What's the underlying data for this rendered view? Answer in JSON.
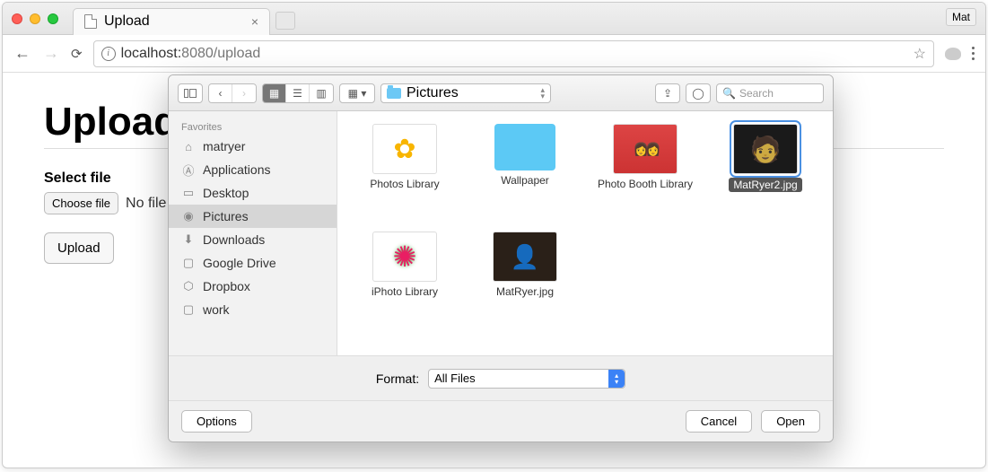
{
  "browser": {
    "tab_title": "Upload",
    "user_badge": "Mat",
    "url_host": "localhost:",
    "url_port_path": "8080/upload"
  },
  "page": {
    "heading": "Upload",
    "label": "Select file",
    "choose_btn": "Choose file",
    "nofile": "No file",
    "upload_btn": "Upload"
  },
  "dialog": {
    "location": "Pictures",
    "search_placeholder": "Search",
    "sidebar_header": "Favorites",
    "sidebar": [
      {
        "icon": "home",
        "label": "matryer"
      },
      {
        "icon": "apps",
        "label": "Applications"
      },
      {
        "icon": "desktop",
        "label": "Desktop"
      },
      {
        "icon": "pictures",
        "label": "Pictures",
        "active": true
      },
      {
        "icon": "downloads",
        "label": "Downloads"
      },
      {
        "icon": "folder",
        "label": "Google Drive"
      },
      {
        "icon": "dropbox",
        "label": "Dropbox"
      },
      {
        "icon": "folder",
        "label": "work"
      }
    ],
    "items": [
      {
        "name": "Photos Library",
        "type": "photos"
      },
      {
        "name": "Wallpaper",
        "type": "folder"
      },
      {
        "name": "Photo Booth Library",
        "type": "booth"
      },
      {
        "name": "MatRyer2.jpg",
        "type": "dark",
        "selected": true
      },
      {
        "name": "iPhoto Library",
        "type": "flower"
      },
      {
        "name": "MatRyer.jpg",
        "type": "person"
      }
    ],
    "format_label": "Format:",
    "format_value": "All Files",
    "options_btn": "Options",
    "cancel_btn": "Cancel",
    "open_btn": "Open"
  }
}
